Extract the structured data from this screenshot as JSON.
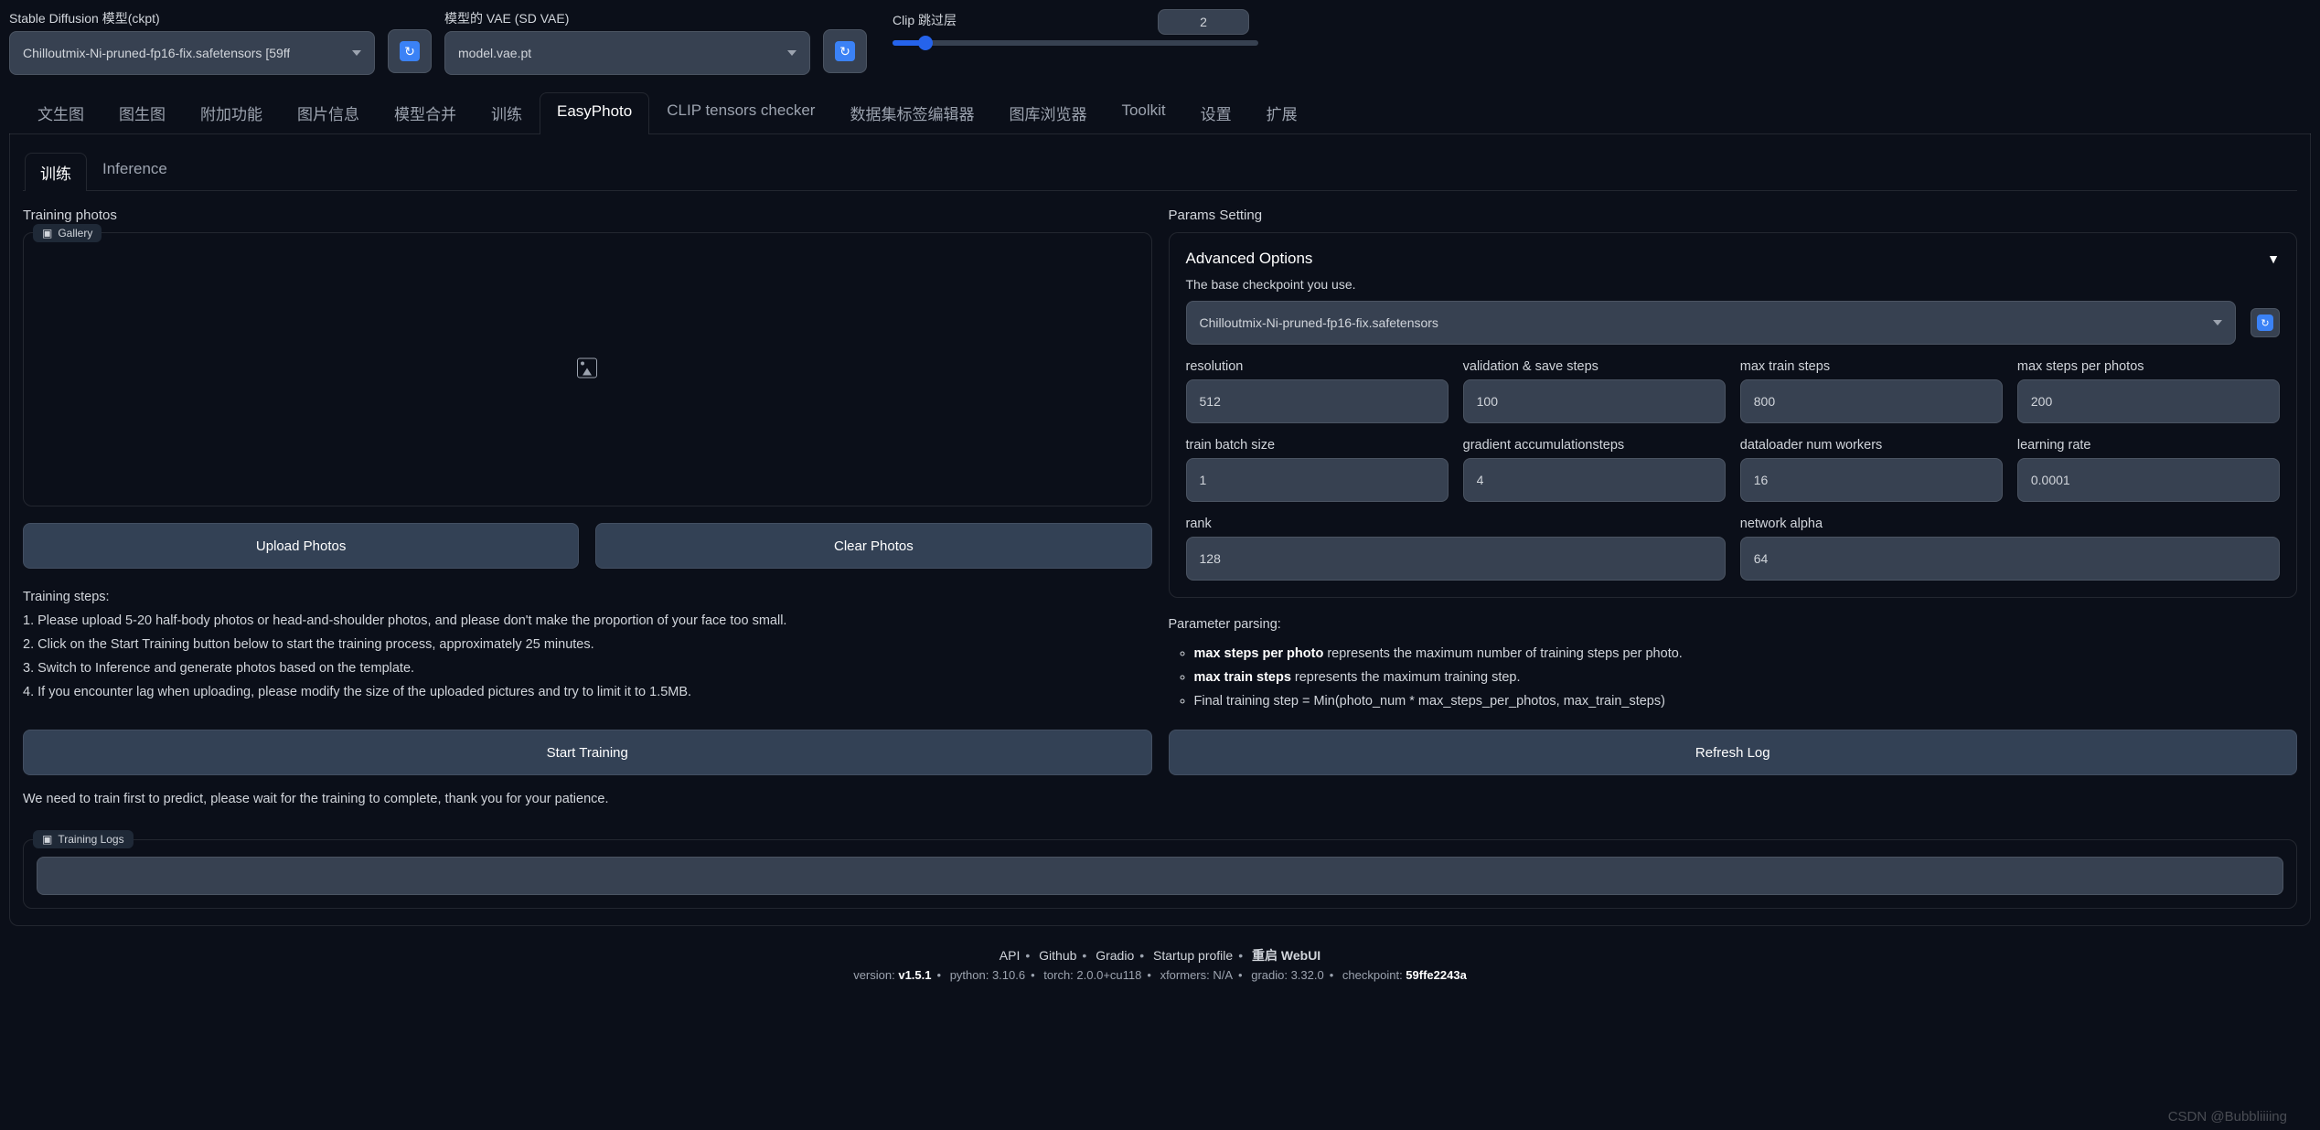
{
  "top": {
    "ckpt_label": "Stable Diffusion 模型(ckpt)",
    "ckpt_value": "Chilloutmix-Ni-pruned-fp16-fix.safetensors [59ff",
    "vae_label": "模型的 VAE (SD VAE)",
    "vae_value": "model.vae.pt",
    "clip_label": "Clip 跳过层",
    "clip_value": "2"
  },
  "tabs": [
    "文生图",
    "图生图",
    "附加功能",
    "图片信息",
    "模型合并",
    "训练",
    "EasyPhoto",
    "CLIP tensors checker",
    "数据集标签编辑器",
    "图库浏览器",
    "Toolkit",
    "设置",
    "扩展"
  ],
  "active_tab": "EasyPhoto",
  "subtabs": {
    "train": "训练",
    "inf": "Inference"
  },
  "left": {
    "title": "Training photos",
    "gallery_tag": "Gallery",
    "upload": "Upload Photos",
    "clear": "Clear Photos",
    "steps_h": "Training steps:",
    "step1": "1. Please upload 5-20 half-body photos or head-and-shoulder photos, and please don't make the proportion of your face too small.",
    "step2": "2. Click on the Start Training button below to start the training process, approximately 25 minutes.",
    "step3": "3. Switch to Inference and generate photos based on the template.",
    "step4": "4. If you encounter lag when uploading, please modify the size of the uploaded pictures and try to limit it to 1.5MB.",
    "start": "Start Training",
    "refresh": "Refresh Log",
    "patience": "We need to train first to predict, please wait for the training to complete, thank you for your patience."
  },
  "right": {
    "title": "Params Setting",
    "adv": "Advanced Options",
    "hint": "The base checkpoint you use.",
    "ckpt": "Chilloutmix-Ni-pruned-fp16-fix.safetensors",
    "labels": {
      "res": "resolution",
      "val": "validation & save steps",
      "maxtrain": "max train steps",
      "maxphoto": "max steps per photos",
      "bs": "train batch size",
      "grad": "gradient accumulationsteps",
      "dl": "dataloader num workers",
      "lr": "learning rate",
      "rank": "rank",
      "na": "network alpha"
    },
    "values": {
      "res": "512",
      "val": "100",
      "maxtrain": "800",
      "maxphoto": "200",
      "bs": "1",
      "grad": "4",
      "dl": "16",
      "lr": "0.0001",
      "rank": "128",
      "na": "64"
    },
    "pp_title": "Parameter parsing:",
    "pp1a": "max steps per photo",
    "pp1b": " represents the maximum number of training steps per photo.",
    "pp2a": "max train steps",
    "pp2b": " represents the maximum training step.",
    "pp3": "Final training step = Min(photo_num * max_steps_per_photos, max_train_steps)"
  },
  "logs": {
    "label": "Training Logs"
  },
  "footer": {
    "api": "API",
    "github": "Github",
    "gradio": "Gradio",
    "startup": "Startup profile",
    "restart": "重启 WebUI",
    "version_label": "version: ",
    "version": "v1.5.1",
    "python": "python: 3.10.6",
    "torch": "torch: 2.0.0+cu118",
    "xformers": "xformers: N/A",
    "gradio_v": "gradio: 3.32.0",
    "ckpt_label": "checkpoint: ",
    "ckpt": "59ffe2243a"
  },
  "watermark": "CSDN @Bubbliiiing"
}
